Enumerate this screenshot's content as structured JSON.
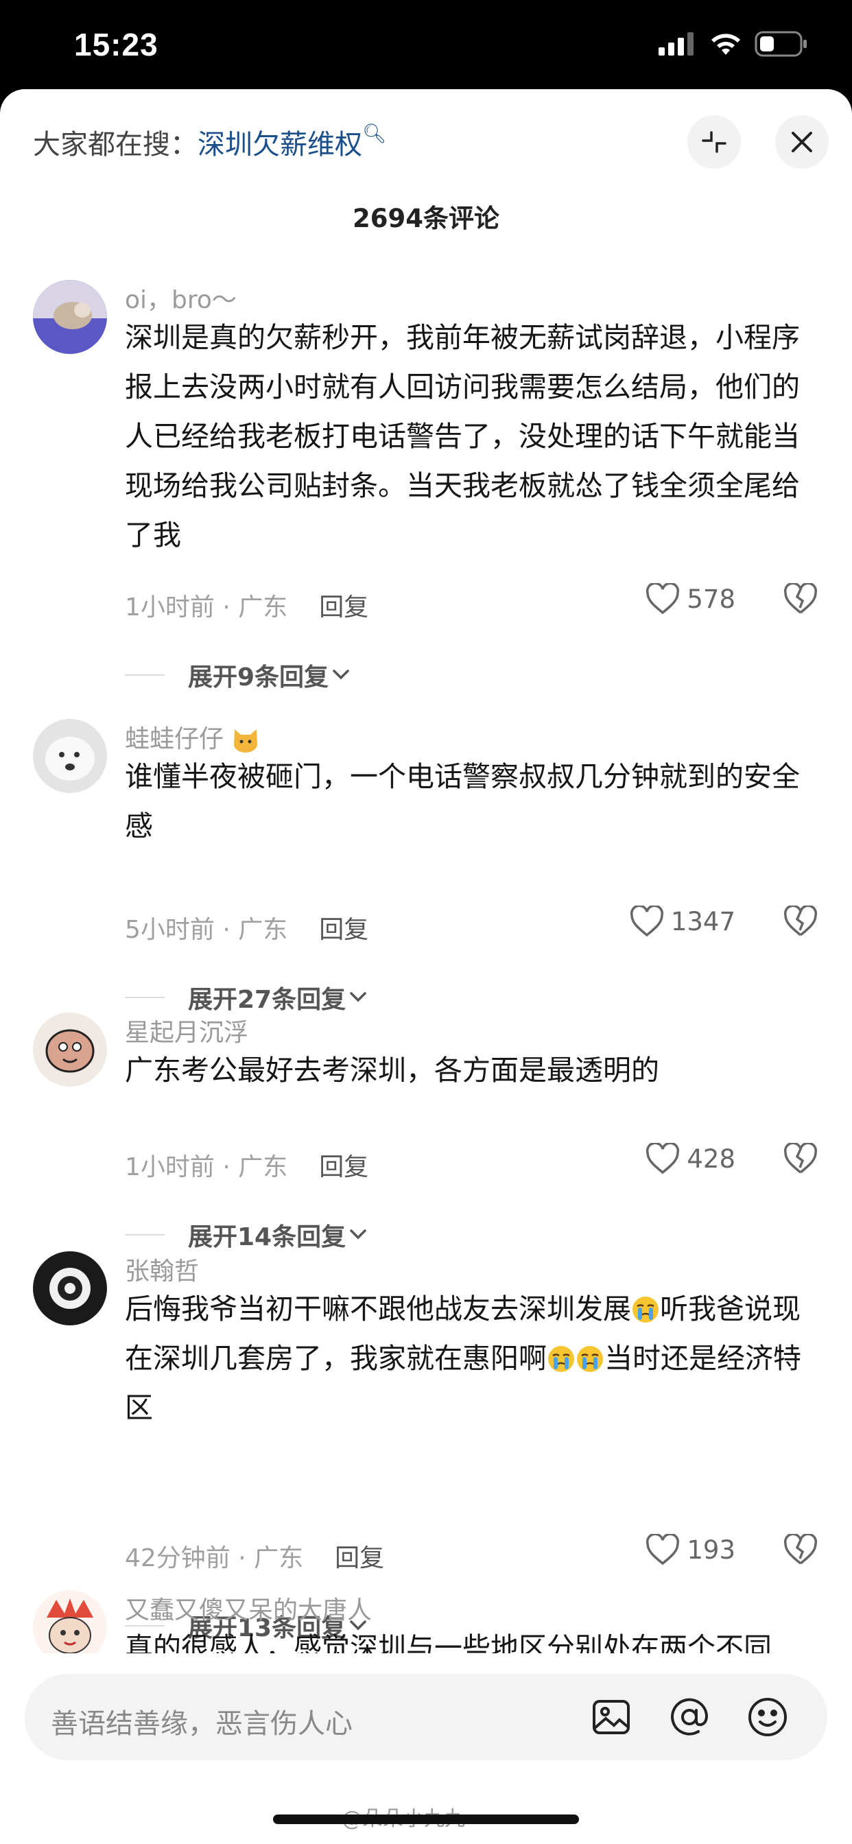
{
  "status_bar": {
    "time": "15:23"
  },
  "header": {
    "hot_search_label": "大家都在搜：",
    "hot_search_term": "深圳欠薪维权",
    "comment_count": "2694条评论"
  },
  "comments": [
    {
      "user": "oi，bro～",
      "text": "深圳是真的欠薪秒开，我前年被无薪试岗辞退，小程序报上去没两小时就有人回访问我需要怎么结局，他们的人已经给我老板打电话警告了，没处理的话下午就能当现场给我公司贴封条。当天我老板就怂了钱全须全尾给了我",
      "meta": "1小时前 · 广东",
      "reply": "回复",
      "likes": "578",
      "expand": "展开9条回复"
    },
    {
      "user": "蛙蛙仔仔",
      "text": "谁懂半夜被砸门，一个电话警察叔叔几分钟就到的安全感",
      "meta": "5小时前 · 广东",
      "reply": "回复",
      "likes": "1347",
      "expand": "展开27条回复"
    },
    {
      "user": "星起月沉浮",
      "text": "广东考公最好去考深圳，各方面是最透明的",
      "meta": "1小时前 · 广东",
      "reply": "回复",
      "likes": "428",
      "expand": "展开14条回复"
    },
    {
      "user": "张翰哲",
      "text_1": "后悔我爷当初干嘛不跟他战友去深圳发展",
      "text_2": "听我爸说现在深圳几套房了，我家就在惠阳啊",
      "text_3": "当时还是经济特区",
      "meta": "42分钟前 · 广东",
      "reply": "回复",
      "likes": "193",
      "expand": "展开13条回复"
    },
    {
      "user": "又蠢又傻又呆的大唐人",
      "text": "真的很感人，感觉深圳与一些地区分别处在两个不同"
    }
  ],
  "input": {
    "placeholder": "善语结善缘，恶言伤人心"
  },
  "watermark": "@朵朵小九九",
  "colors": {
    "link": "#1a4f8c",
    "meta": "#a0a0a0",
    "background": "#ffffff"
  }
}
